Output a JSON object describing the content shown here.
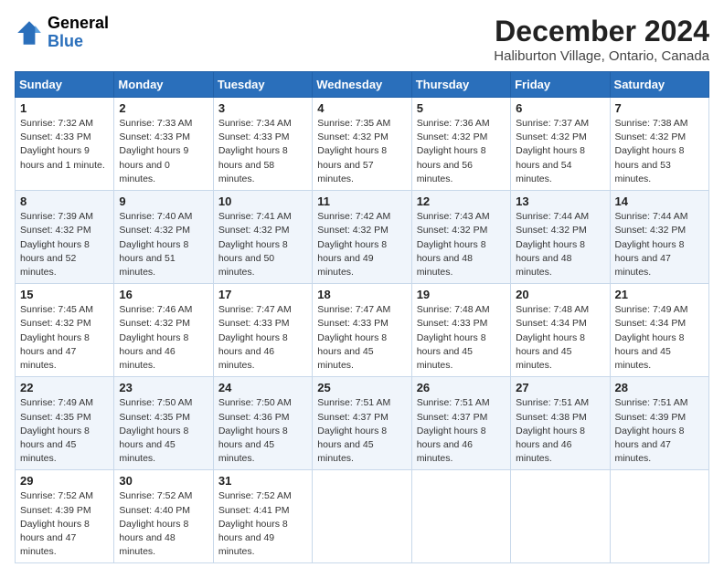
{
  "header": {
    "logo_line1": "General",
    "logo_line2": "Blue",
    "month_title": "December 2024",
    "location": "Haliburton Village, Ontario, Canada"
  },
  "days_of_week": [
    "Sunday",
    "Monday",
    "Tuesday",
    "Wednesday",
    "Thursday",
    "Friday",
    "Saturday"
  ],
  "weeks": [
    [
      {
        "day": 1,
        "sunrise": "7:32 AM",
        "sunset": "4:33 PM",
        "daylight": "9 hours and 1 minute."
      },
      {
        "day": 2,
        "sunrise": "7:33 AM",
        "sunset": "4:33 PM",
        "daylight": "9 hours and 0 minutes."
      },
      {
        "day": 3,
        "sunrise": "7:34 AM",
        "sunset": "4:33 PM",
        "daylight": "8 hours and 58 minutes."
      },
      {
        "day": 4,
        "sunrise": "7:35 AM",
        "sunset": "4:32 PM",
        "daylight": "8 hours and 57 minutes."
      },
      {
        "day": 5,
        "sunrise": "7:36 AM",
        "sunset": "4:32 PM",
        "daylight": "8 hours and 56 minutes."
      },
      {
        "day": 6,
        "sunrise": "7:37 AM",
        "sunset": "4:32 PM",
        "daylight": "8 hours and 54 minutes."
      },
      {
        "day": 7,
        "sunrise": "7:38 AM",
        "sunset": "4:32 PM",
        "daylight": "8 hours and 53 minutes."
      }
    ],
    [
      {
        "day": 8,
        "sunrise": "7:39 AM",
        "sunset": "4:32 PM",
        "daylight": "8 hours and 52 minutes."
      },
      {
        "day": 9,
        "sunrise": "7:40 AM",
        "sunset": "4:32 PM",
        "daylight": "8 hours and 51 minutes."
      },
      {
        "day": 10,
        "sunrise": "7:41 AM",
        "sunset": "4:32 PM",
        "daylight": "8 hours and 50 minutes."
      },
      {
        "day": 11,
        "sunrise": "7:42 AM",
        "sunset": "4:32 PM",
        "daylight": "8 hours and 49 minutes."
      },
      {
        "day": 12,
        "sunrise": "7:43 AM",
        "sunset": "4:32 PM",
        "daylight": "8 hours and 48 minutes."
      },
      {
        "day": 13,
        "sunrise": "7:44 AM",
        "sunset": "4:32 PM",
        "daylight": "8 hours and 48 minutes."
      },
      {
        "day": 14,
        "sunrise": "7:44 AM",
        "sunset": "4:32 PM",
        "daylight": "8 hours and 47 minutes."
      }
    ],
    [
      {
        "day": 15,
        "sunrise": "7:45 AM",
        "sunset": "4:32 PM",
        "daylight": "8 hours and 47 minutes."
      },
      {
        "day": 16,
        "sunrise": "7:46 AM",
        "sunset": "4:32 PM",
        "daylight": "8 hours and 46 minutes."
      },
      {
        "day": 17,
        "sunrise": "7:47 AM",
        "sunset": "4:33 PM",
        "daylight": "8 hours and 46 minutes."
      },
      {
        "day": 18,
        "sunrise": "7:47 AM",
        "sunset": "4:33 PM",
        "daylight": "8 hours and 45 minutes."
      },
      {
        "day": 19,
        "sunrise": "7:48 AM",
        "sunset": "4:33 PM",
        "daylight": "8 hours and 45 minutes."
      },
      {
        "day": 20,
        "sunrise": "7:48 AM",
        "sunset": "4:34 PM",
        "daylight": "8 hours and 45 minutes."
      },
      {
        "day": 21,
        "sunrise": "7:49 AM",
        "sunset": "4:34 PM",
        "daylight": "8 hours and 45 minutes."
      }
    ],
    [
      {
        "day": 22,
        "sunrise": "7:49 AM",
        "sunset": "4:35 PM",
        "daylight": "8 hours and 45 minutes."
      },
      {
        "day": 23,
        "sunrise": "7:50 AM",
        "sunset": "4:35 PM",
        "daylight": "8 hours and 45 minutes."
      },
      {
        "day": 24,
        "sunrise": "7:50 AM",
        "sunset": "4:36 PM",
        "daylight": "8 hours and 45 minutes."
      },
      {
        "day": 25,
        "sunrise": "7:51 AM",
        "sunset": "4:37 PM",
        "daylight": "8 hours and 45 minutes."
      },
      {
        "day": 26,
        "sunrise": "7:51 AM",
        "sunset": "4:37 PM",
        "daylight": "8 hours and 46 minutes."
      },
      {
        "day": 27,
        "sunrise": "7:51 AM",
        "sunset": "4:38 PM",
        "daylight": "8 hours and 46 minutes."
      },
      {
        "day": 28,
        "sunrise": "7:51 AM",
        "sunset": "4:39 PM",
        "daylight": "8 hours and 47 minutes."
      }
    ],
    [
      {
        "day": 29,
        "sunrise": "7:52 AM",
        "sunset": "4:39 PM",
        "daylight": "8 hours and 47 minutes."
      },
      {
        "day": 30,
        "sunrise": "7:52 AM",
        "sunset": "4:40 PM",
        "daylight": "8 hours and 48 minutes."
      },
      {
        "day": 31,
        "sunrise": "7:52 AM",
        "sunset": "4:41 PM",
        "daylight": "8 hours and 49 minutes."
      },
      null,
      null,
      null,
      null
    ]
  ]
}
